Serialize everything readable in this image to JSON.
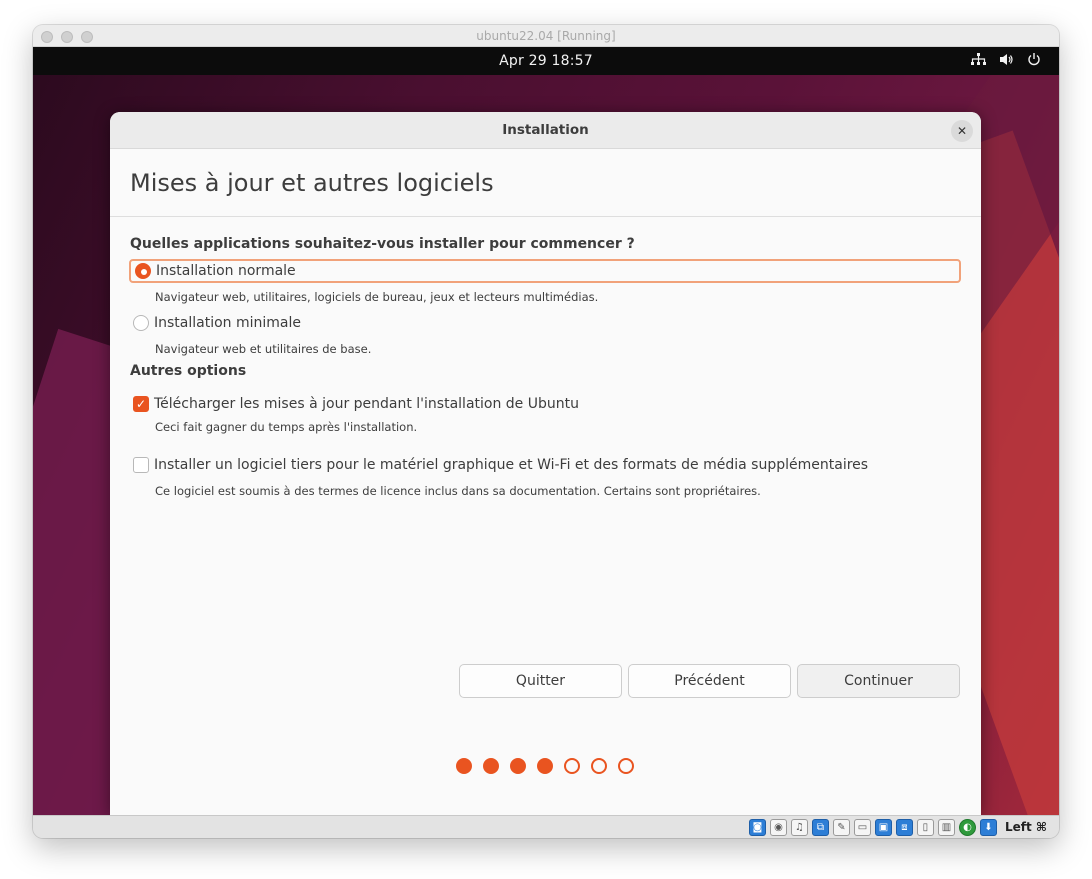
{
  "vm_window": {
    "title": "ubuntu22.04 [Running]"
  },
  "topbar": {
    "clock": "Apr 29  18:57",
    "icons": [
      "network-icon",
      "volume-icon",
      "power-icon"
    ]
  },
  "installer": {
    "window_title": "Installation",
    "close_symbol": "✕",
    "heading": "Mises à jour et autres logiciels",
    "question": "Quelles applications souhaitez-vous installer pour commencer ?",
    "options": [
      {
        "label": "Installation normale",
        "description": "Navigateur web, utilitaires, logiciels de bureau, jeux et lecteurs multimédias.",
        "selected": true
      },
      {
        "label": "Installation minimale",
        "description": "Navigateur web et utilitaires de base.",
        "selected": false
      }
    ],
    "other_options_label": "Autres options",
    "checkboxes": [
      {
        "label": "Télécharger les mises à jour pendant l'installation de Ubuntu",
        "description": "Ceci fait gagner du temps après l'installation.",
        "checked": true
      },
      {
        "label": "Installer un logiciel tiers pour le matériel graphique et Wi-Fi et des formats de média supplémentaires",
        "description": "Ce logiciel est soumis à des termes de licence inclus dans sa documentation. Certains sont propriétaires.",
        "checked": false
      }
    ],
    "buttons": {
      "quit": "Quitter",
      "back": "Précédent",
      "continue": "Continuer"
    },
    "progress": {
      "total_steps": 7,
      "completed_steps": 4
    },
    "accent_color": "#e95420"
  },
  "statusbar": {
    "icons": [
      "hard-disk-icon",
      "optical-disk-icon",
      "audio-icon",
      "network-adapters-icon",
      "usb-icon",
      "shared-folders-icon",
      "display-icon",
      "video-capture-icon",
      "recording-icon",
      "cpu-icon",
      "guest-additions-icon",
      "mouse-integration-icon"
    ],
    "host_key": "Left ⌘"
  }
}
